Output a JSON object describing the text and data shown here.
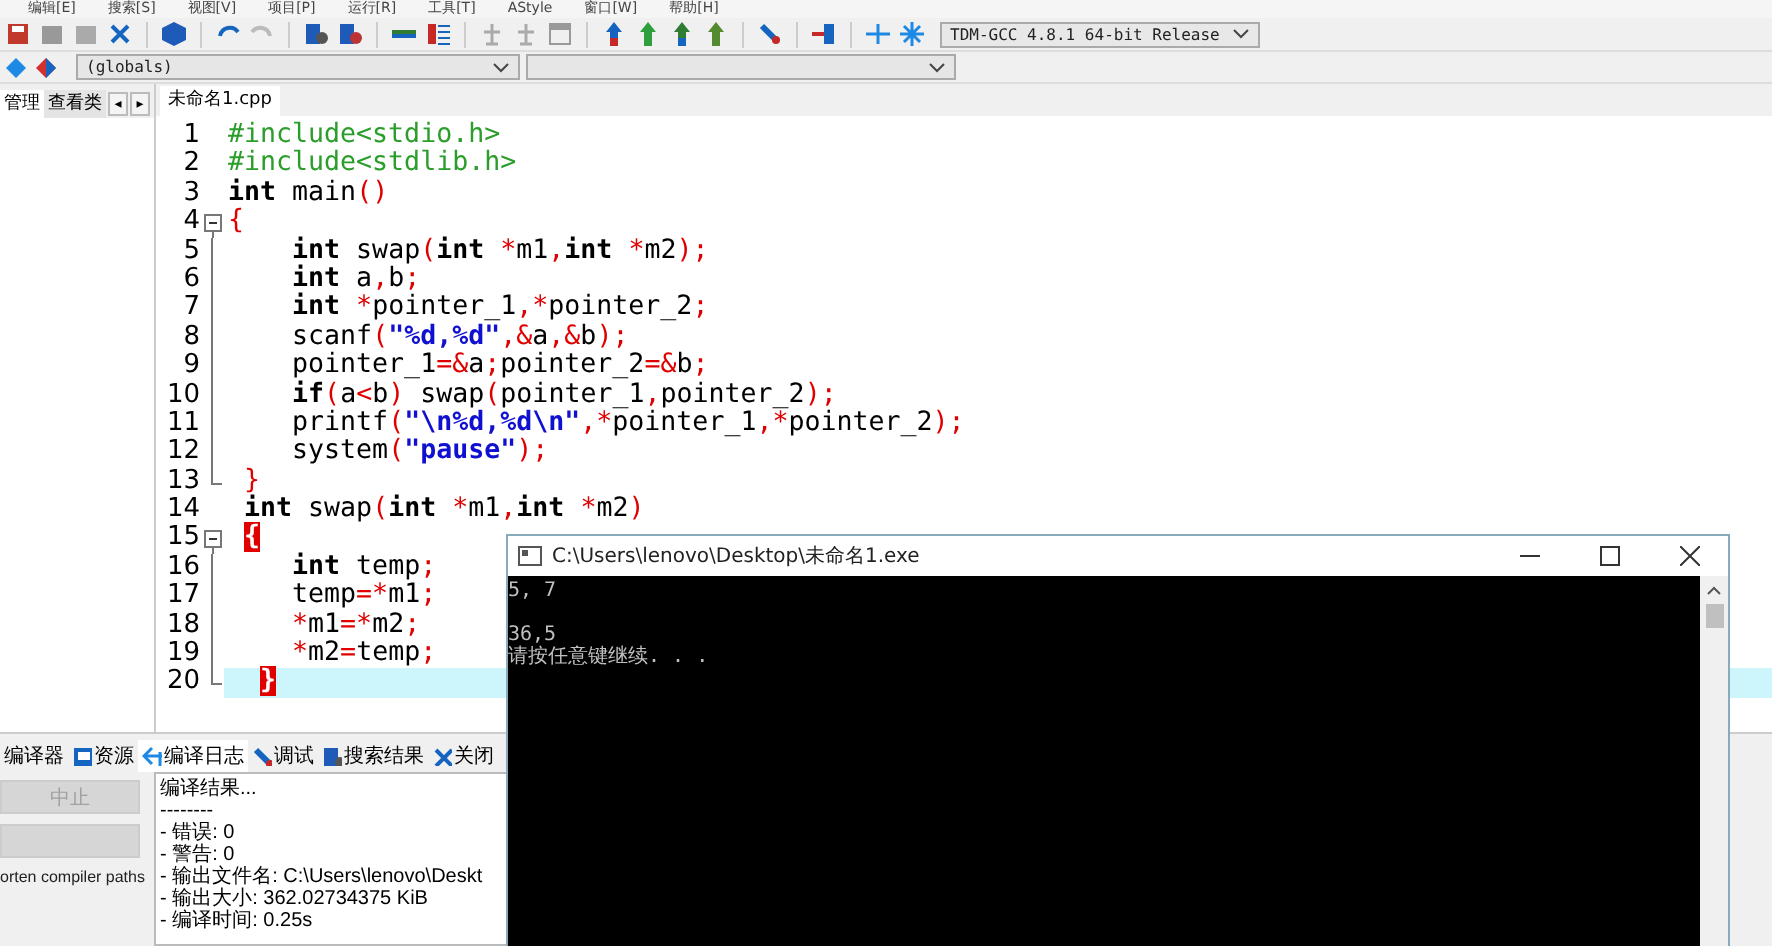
{
  "menu": [
    "编辑[E]",
    "搜索[S]",
    "视图[V]",
    "项目[P]",
    "运行[R]",
    "工具[T]",
    "AStyle",
    "窗口[W]",
    "帮助[H]"
  ],
  "toolbar": {
    "compiler": "TDM-GCC 4.8.1 64-bit Release"
  },
  "scope": {
    "value": "(globals)"
  },
  "left_tabs": [
    {
      "label": "管理",
      "selected": true
    },
    {
      "label": "查看类",
      "selected": false
    }
  ],
  "left_tab_arrows": [
    "◂",
    "▸"
  ],
  "editor_tabs": [
    {
      "label": "未命名1.cpp",
      "selected": true
    }
  ],
  "code": [
    {
      "n": "1",
      "fold_start": false,
      "fold_end": false,
      "current": false,
      "tokens": [
        {
          "t": "#include<stdio.h>",
          "kind": "pre"
        }
      ]
    },
    {
      "n": "2",
      "fold_start": false,
      "fold_end": false,
      "current": false,
      "tokens": [
        {
          "t": "#include<stdlib.h>",
          "kind": "pre"
        }
      ]
    },
    {
      "n": "3",
      "fold_start": false,
      "fold_end": false,
      "current": false,
      "tokens": [
        {
          "t": "int",
          "kind": "kw"
        },
        {
          "t": " main",
          "kind": "txt"
        },
        {
          "t": "()",
          "kind": "sym"
        }
      ]
    },
    {
      "n": "4",
      "fold_start": true,
      "fold_end": false,
      "current": false,
      "tokens": [
        {
          "t": "{",
          "kind": "sym"
        }
      ]
    },
    {
      "n": "5",
      "fold_start": false,
      "fold_end": false,
      "current": false,
      "tokens": [
        {
          "t": "    int",
          "kind": "kw"
        },
        {
          "t": " swap",
          "kind": "txt"
        },
        {
          "t": "(",
          "kind": "sym"
        },
        {
          "t": "int",
          "kind": "kw"
        },
        {
          "t": " *",
          "kind": "sym"
        },
        {
          "t": "m1",
          "kind": "txt"
        },
        {
          "t": ",",
          "kind": "sym"
        },
        {
          "t": "int",
          "kind": "kw"
        },
        {
          "t": " *",
          "kind": "sym"
        },
        {
          "t": "m2",
          "kind": "txt"
        },
        {
          "t": ");",
          "kind": "sym"
        }
      ]
    },
    {
      "n": "6",
      "fold_start": false,
      "fold_end": false,
      "current": false,
      "tokens": [
        {
          "t": "    int",
          "kind": "kw"
        },
        {
          "t": " a",
          "kind": "txt"
        },
        {
          "t": ",",
          "kind": "sym"
        },
        {
          "t": "b",
          "kind": "txt"
        },
        {
          "t": ";",
          "kind": "sym"
        }
      ]
    },
    {
      "n": "7",
      "fold_start": false,
      "fold_end": false,
      "current": false,
      "tokens": [
        {
          "t": "    int",
          "kind": "kw"
        },
        {
          "t": " *",
          "kind": "sym"
        },
        {
          "t": "pointer_1",
          "kind": "txt"
        },
        {
          "t": ",*",
          "kind": "sym"
        },
        {
          "t": "pointer_2",
          "kind": "txt"
        },
        {
          "t": ";",
          "kind": "sym"
        }
      ]
    },
    {
      "n": "8",
      "fold_start": false,
      "fold_end": false,
      "current": false,
      "tokens": [
        {
          "t": "    scanf",
          "kind": "txt"
        },
        {
          "t": "(",
          "kind": "sym"
        },
        {
          "t": "\"%d,%d\"",
          "kind": "str"
        },
        {
          "t": ",&",
          "kind": "sym"
        },
        {
          "t": "a",
          "kind": "txt"
        },
        {
          "t": ",&",
          "kind": "sym"
        },
        {
          "t": "b",
          "kind": "txt"
        },
        {
          "t": ");",
          "kind": "sym"
        }
      ]
    },
    {
      "n": "9",
      "fold_start": false,
      "fold_end": false,
      "current": false,
      "tokens": [
        {
          "t": "    pointer_1",
          "kind": "txt"
        },
        {
          "t": "=&",
          "kind": "sym"
        },
        {
          "t": "a",
          "kind": "txt"
        },
        {
          "t": ";",
          "kind": "sym"
        },
        {
          "t": "pointer_2",
          "kind": "txt"
        },
        {
          "t": "=&",
          "kind": "sym"
        },
        {
          "t": "b",
          "kind": "txt"
        },
        {
          "t": ";",
          "kind": "sym"
        }
      ]
    },
    {
      "n": "10",
      "fold_start": false,
      "fold_end": false,
      "current": false,
      "tokens": [
        {
          "t": "    if",
          "kind": "kw"
        },
        {
          "t": "(",
          "kind": "sym"
        },
        {
          "t": "a",
          "kind": "txt"
        },
        {
          "t": "<",
          "kind": "sym"
        },
        {
          "t": "b",
          "kind": "txt"
        },
        {
          "t": ")",
          "kind": "sym"
        },
        {
          "t": " swap",
          "kind": "txt"
        },
        {
          "t": "(",
          "kind": "sym"
        },
        {
          "t": "pointer_1",
          "kind": "txt"
        },
        {
          "t": ",",
          "kind": "sym"
        },
        {
          "t": "pointer_2",
          "kind": "txt"
        },
        {
          "t": ");",
          "kind": "sym"
        }
      ]
    },
    {
      "n": "11",
      "fold_start": false,
      "fold_end": false,
      "current": false,
      "tokens": [
        {
          "t": "    printf",
          "kind": "txt"
        },
        {
          "t": "(",
          "kind": "sym"
        },
        {
          "t": "\"\\n%d,%d\\n\"",
          "kind": "str"
        },
        {
          "t": ",*",
          "kind": "sym"
        },
        {
          "t": "pointer_1",
          "kind": "txt"
        },
        {
          "t": ",*",
          "kind": "sym"
        },
        {
          "t": "pointer_2",
          "kind": "txt"
        },
        {
          "t": ");",
          "kind": "sym"
        }
      ]
    },
    {
      "n": "12",
      "fold_start": false,
      "fold_end": false,
      "current": false,
      "tokens": [
        {
          "t": "    system",
          "kind": "txt"
        },
        {
          "t": "(",
          "kind": "sym"
        },
        {
          "t": "\"pause\"",
          "kind": "str"
        },
        {
          "t": ");",
          "kind": "sym"
        }
      ]
    },
    {
      "n": "13",
      "fold_start": false,
      "fold_end": true,
      "current": false,
      "tokens": [
        {
          "t": " }",
          "kind": "sym"
        }
      ]
    },
    {
      "n": "14",
      "fold_start": false,
      "fold_end": false,
      "current": false,
      "tokens": [
        {
          "t": " int",
          "kind": "kw"
        },
        {
          "t": " swap",
          "kind": "txt"
        },
        {
          "t": "(",
          "kind": "sym"
        },
        {
          "t": "int",
          "kind": "kw"
        },
        {
          "t": " *",
          "kind": "sym"
        },
        {
          "t": "m1",
          "kind": "txt"
        },
        {
          "t": ",",
          "kind": "sym"
        },
        {
          "t": "int",
          "kind": "kw"
        },
        {
          "t": " *",
          "kind": "sym"
        },
        {
          "t": "m2",
          "kind": "txt"
        },
        {
          "t": ")",
          "kind": "sym"
        }
      ]
    },
    {
      "n": "15",
      "fold_start": true,
      "fold_end": false,
      "current": false,
      "tokens": [
        {
          "t": " {",
          "kind": "match"
        }
      ]
    },
    {
      "n": "16",
      "fold_start": false,
      "fold_end": false,
      "current": false,
      "tokens": [
        {
          "t": "    int",
          "kind": "kw"
        },
        {
          "t": " temp",
          "kind": "txt"
        },
        {
          "t": ";",
          "kind": "sym"
        }
      ]
    },
    {
      "n": "17",
      "fold_start": false,
      "fold_end": false,
      "current": false,
      "tokens": [
        {
          "t": "    temp",
          "kind": "txt"
        },
        {
          "t": "=*",
          "kind": "sym"
        },
        {
          "t": "m1",
          "kind": "txt"
        },
        {
          "t": ";",
          "kind": "sym"
        }
      ]
    },
    {
      "n": "18",
      "fold_start": false,
      "fold_end": false,
      "current": false,
      "tokens": [
        {
          "t": "    *",
          "kind": "sym"
        },
        {
          "t": "m1",
          "kind": "txt"
        },
        {
          "t": "=*",
          "kind": "sym"
        },
        {
          "t": "m2",
          "kind": "txt"
        },
        {
          "t": ";",
          "kind": "sym"
        }
      ]
    },
    {
      "n": "19",
      "fold_start": false,
      "fold_end": false,
      "current": false,
      "tokens": [
        {
          "t": "    *",
          "kind": "sym"
        },
        {
          "t": "m2",
          "kind": "txt"
        },
        {
          "t": "=",
          "kind": "sym"
        },
        {
          "t": "temp",
          "kind": "txt"
        },
        {
          "t": ";",
          "kind": "sym"
        }
      ]
    },
    {
      "n": "20",
      "fold_start": false,
      "fold_end": true,
      "current": true,
      "tokens": [
        {
          "t": "  }",
          "kind": "match"
        }
      ]
    }
  ],
  "bottom_tabs": [
    {
      "label": "编译器",
      "selected": false
    },
    {
      "label": "资源",
      "selected": false
    },
    {
      "label": "编译日志",
      "selected": true
    },
    {
      "label": "调试",
      "selected": false
    },
    {
      "label": "搜索结果",
      "selected": false
    },
    {
      "label": "关闭",
      "selected": false
    }
  ],
  "bottom_buttons": [
    {
      "label": "中止",
      "disabled": true
    },
    {
      "disabled": true
    }
  ],
  "option_label": "orten compiler paths",
  "log": [
    "编译结果...",
    "--------",
    "- 错误: 0",
    "- 警告: 0",
    "- 输出文件名: C:\\Users\\lenovo\\Deskt",
    "- 输出大小: 362.02734375 KiB",
    "- 编译时间: 0.25s"
  ],
  "console": {
    "title": "C:\\Users\\lenovo\\Desktop\\未命名1.exe",
    "lines": [
      {
        "text": "5, 7",
        "blank_before": false
      },
      {
        "text": "36,5",
        "blank_before": true
      },
      {
        "text": "请按任意键继续. . .",
        "blank_before": false
      }
    ]
  }
}
